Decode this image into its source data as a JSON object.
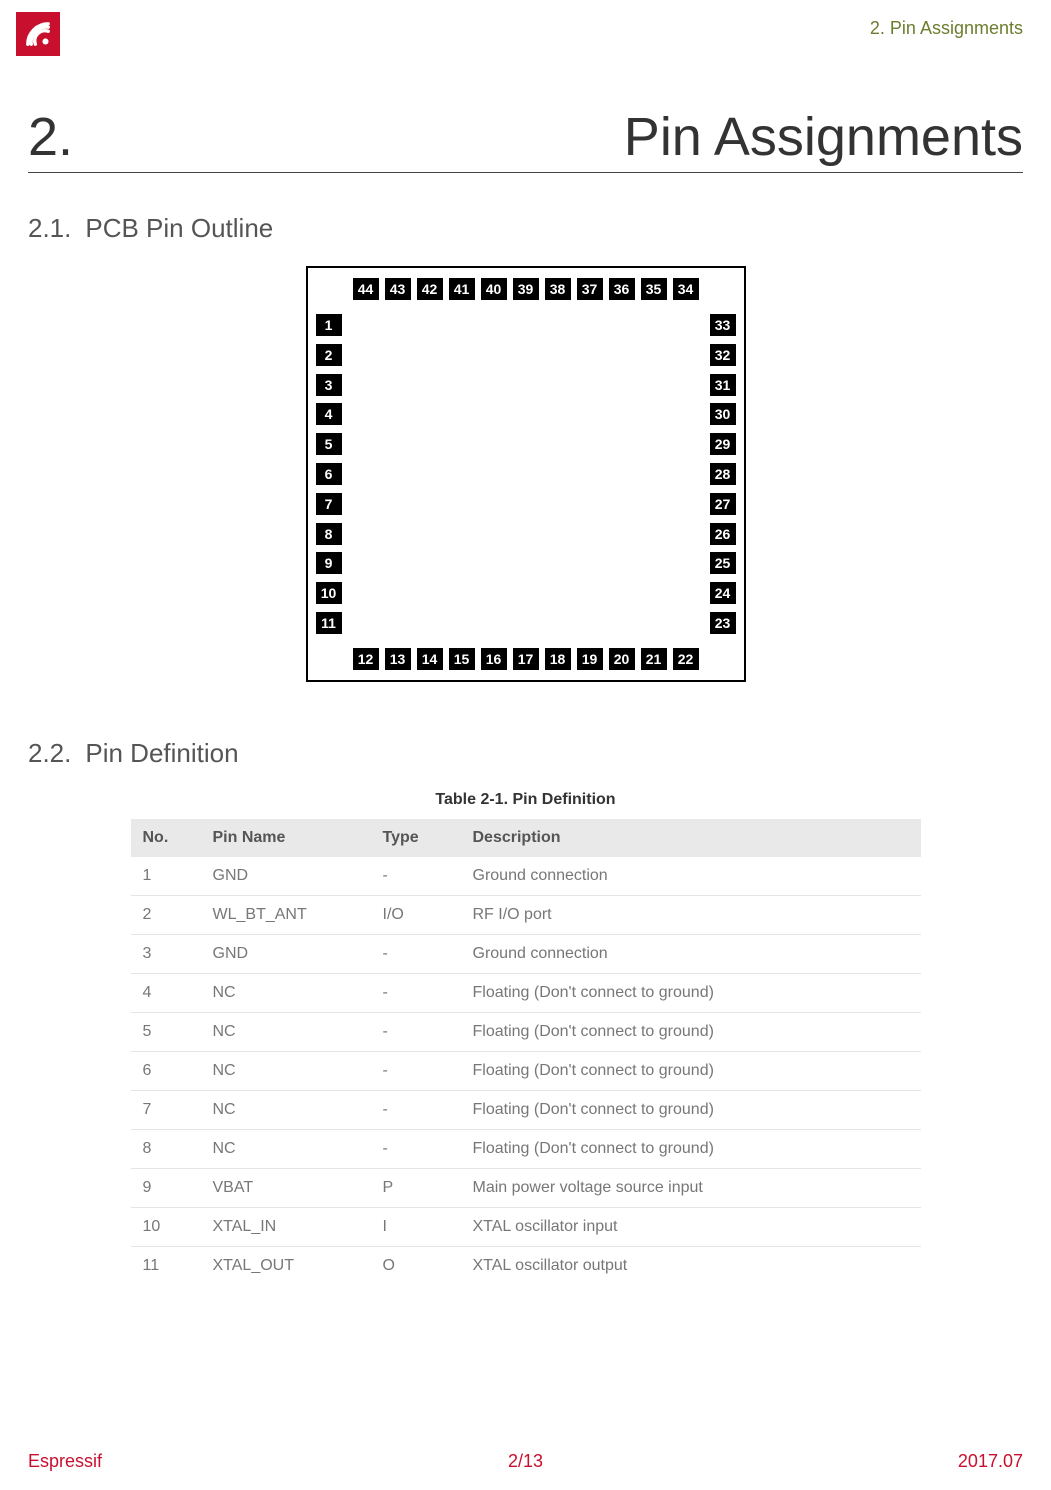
{
  "header": {
    "section_label": "2. Pin Assignments"
  },
  "title": {
    "number": "2.",
    "text": "Pin Assignments"
  },
  "sections": {
    "s21": {
      "num": "2.1.",
      "title": "PCB Pin Outline"
    },
    "s22": {
      "num": "2.2.",
      "title": "Pin Definition"
    }
  },
  "diagram": {
    "top": [
      "44",
      "43",
      "42",
      "41",
      "40",
      "39",
      "38",
      "37",
      "36",
      "35",
      "34"
    ],
    "left": [
      "1",
      "2",
      "3",
      "4",
      "5",
      "6",
      "7",
      "8",
      "9",
      "10",
      "11"
    ],
    "right": [
      "33",
      "32",
      "31",
      "30",
      "29",
      "28",
      "27",
      "26",
      "25",
      "24",
      "23"
    ],
    "bottom": [
      "12",
      "13",
      "14",
      "15",
      "16",
      "17",
      "18",
      "19",
      "20",
      "21",
      "22"
    ]
  },
  "table": {
    "caption": "Table 2-1. Pin Definition",
    "headers": {
      "no": "No.",
      "name": "Pin Name",
      "type": "Type",
      "desc": "Description"
    },
    "rows": [
      {
        "no": "1",
        "name": "GND",
        "type": "-",
        "desc": "Ground connection"
      },
      {
        "no": "2",
        "name": "WL_BT_ANT",
        "type": "I/O",
        "desc": "RF I/O port"
      },
      {
        "no": "3",
        "name": "GND",
        "type": "-",
        "desc": "Ground connection"
      },
      {
        "no": "4",
        "name": "NC",
        "type": "-",
        "desc": "Floating (Don't connect to ground)"
      },
      {
        "no": "5",
        "name": "NC",
        "type": "-",
        "desc": "Floating (Don't connect to ground)"
      },
      {
        "no": "6",
        "name": "NC",
        "type": "-",
        "desc": "Floating (Don't connect to ground)"
      },
      {
        "no": "7",
        "name": "NC",
        "type": "-",
        "desc": "Floating (Don't connect to ground)"
      },
      {
        "no": "8",
        "name": "NC",
        "type": "-",
        "desc": "Floating (Don't connect to ground)"
      },
      {
        "no": "9",
        "name": "VBAT",
        "type": "P",
        "desc": "Main power voltage source input"
      },
      {
        "no": "10",
        "name": "XTAL_IN",
        "type": "I",
        "desc": "XTAL oscillator input"
      },
      {
        "no": "11",
        "name": "XTAL_OUT",
        "type": "O",
        "desc": "XTAL oscillator output"
      }
    ]
  },
  "footer": {
    "left": "Espressif",
    "center": "2/13",
    "right": "2017.07"
  }
}
